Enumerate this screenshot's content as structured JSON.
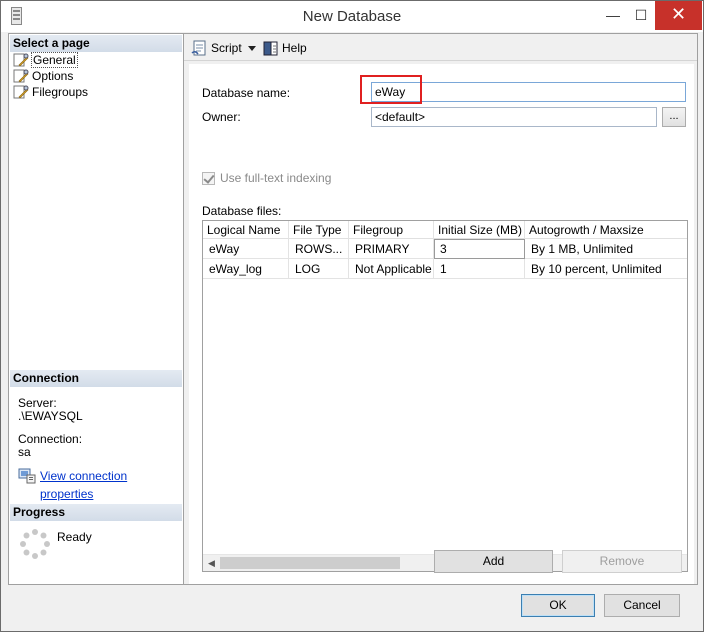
{
  "window": {
    "title": "New Database"
  },
  "titlebar": {
    "minimize": "—",
    "maximize": "☐",
    "close": "✕"
  },
  "sidebar": {
    "select_page_header": "Select a page",
    "pages": [
      {
        "label": "General",
        "selected": true
      },
      {
        "label": "Options",
        "selected": false
      },
      {
        "label": "Filegroups",
        "selected": false
      }
    ],
    "connection_header": "Connection",
    "server_label": "Server:",
    "server_value": ".\\EWAYSQL",
    "connection_label": "Connection:",
    "connection_value": "sa",
    "view_connection_link": "View connection properties",
    "progress_header": "Progress",
    "progress_status": "Ready"
  },
  "toolbar": {
    "script_label": "Script",
    "help_label": "Help"
  },
  "form": {
    "database_name_label": "Database name:",
    "database_name_value": "eWay",
    "owner_label": "Owner:",
    "owner_value": "<default>",
    "browse_label": "...",
    "fulltext_label": "Use full-text indexing",
    "fulltext_checked": true,
    "database_files_label": "Database files:"
  },
  "files_table": {
    "columns": [
      "Logical Name",
      "File Type",
      "Filegroup",
      "Initial Size (MB)",
      "Autogrowth / Maxsize"
    ],
    "rows": [
      [
        "eWay",
        "ROWS...",
        "PRIMARY",
        "3",
        "By 1 MB, Unlimited"
      ],
      [
        "eWay_log",
        "LOG",
        "Not Applicable",
        "1",
        "By 10 percent, Unlimited"
      ]
    ]
  },
  "actions": {
    "add_label": "Add",
    "remove_label": "Remove"
  },
  "dialog": {
    "ok_label": "OK",
    "cancel_label": "Cancel"
  },
  "colors": {
    "highlight": "#e02020",
    "link": "#0033cc",
    "close_bg": "#c7312a"
  }
}
